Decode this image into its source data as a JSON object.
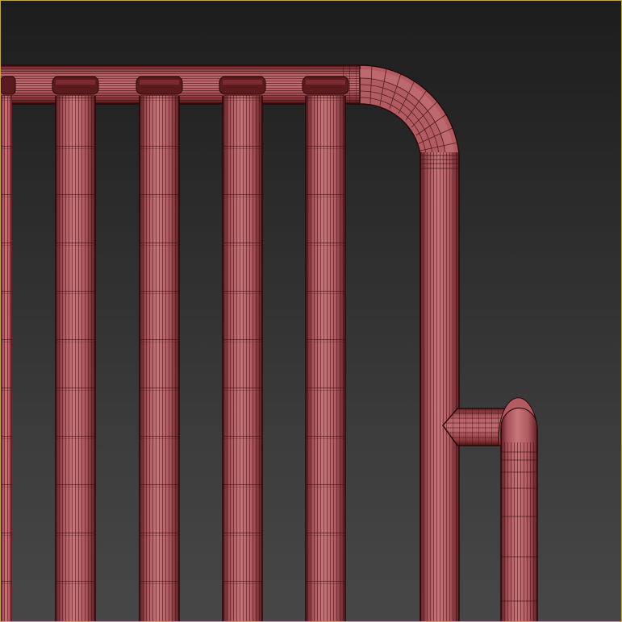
{
  "viewport": {
    "mode": "wireframe-on-shaded",
    "background_top": "#1d1d1d",
    "background_bottom": "#474747",
    "border_color": "#c9a54a"
  },
  "object": {
    "name": "pipe-railing",
    "base_color": "#b3585e",
    "highlight_color": "#c7767b",
    "shadow_color": "#7a2a2e",
    "wire_color": "#3a0c0c",
    "components": [
      "top-rail",
      "corner-bend",
      "vertical-post",
      "balusters",
      "side-arm",
      "side-leg"
    ]
  }
}
